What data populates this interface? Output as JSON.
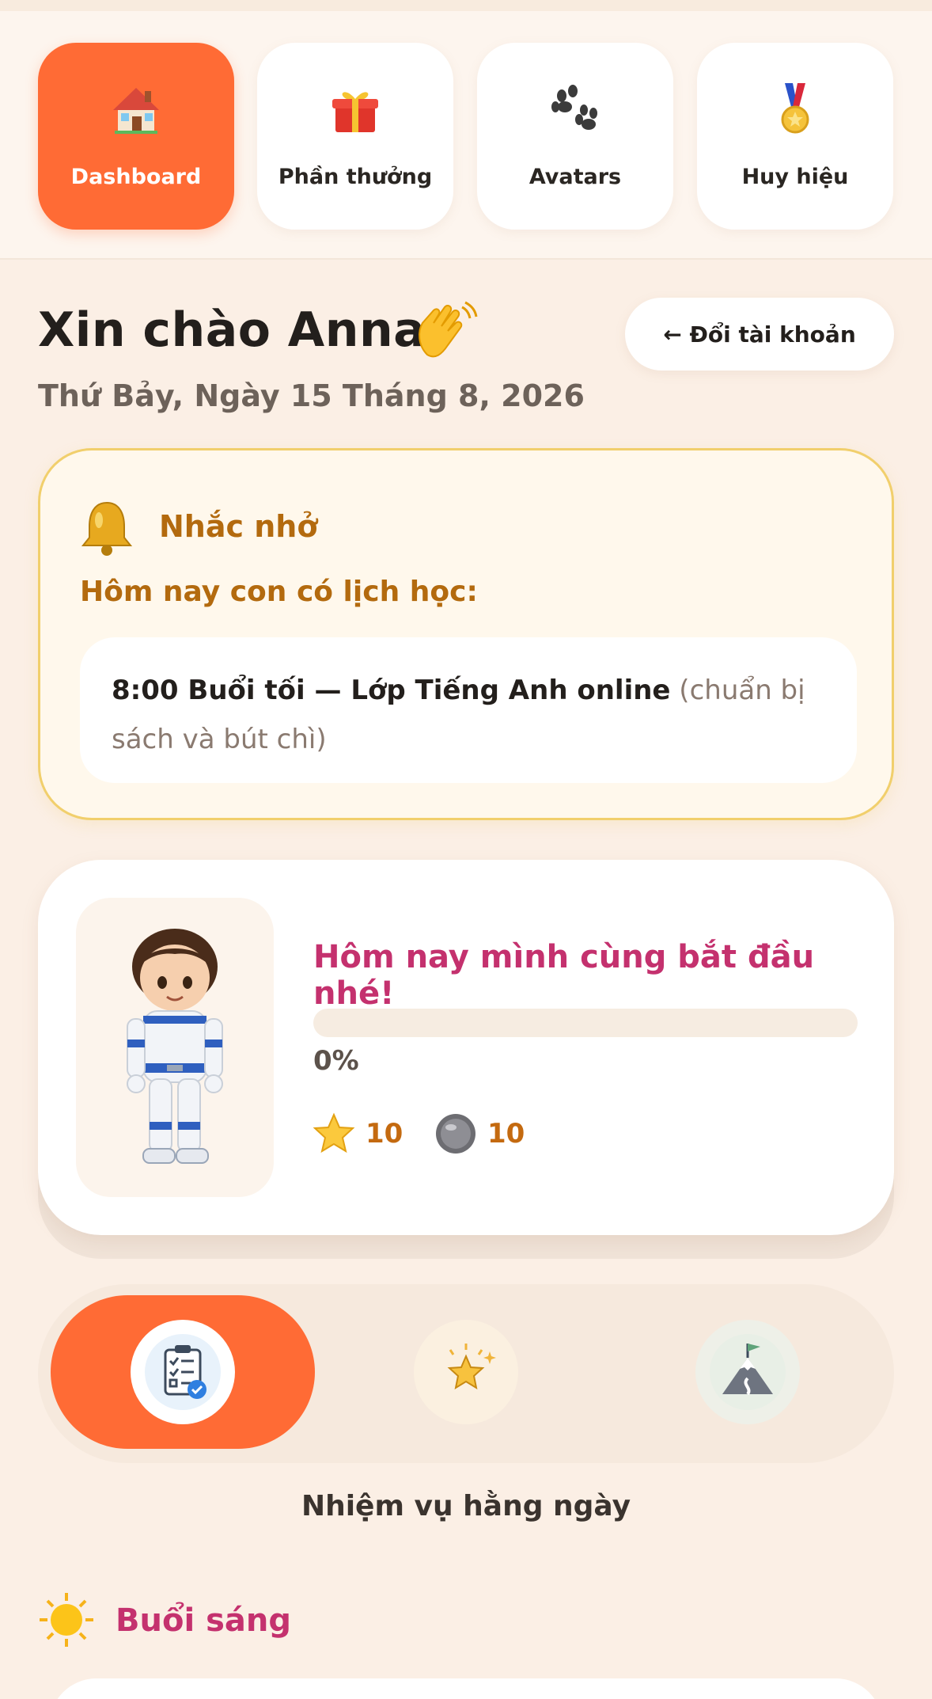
{
  "nav": {
    "tabs": [
      {
        "label": "Dashboard",
        "icon": "house-icon",
        "active": true
      },
      {
        "label": "Phần thưởng",
        "icon": "gift-icon",
        "active": false
      },
      {
        "label": "Avatars",
        "icon": "paw-icon",
        "active": false
      },
      {
        "label": "Huy hiệu",
        "icon": "medal-icon",
        "active": false
      }
    ]
  },
  "header": {
    "greeting": "Xin chào Anna",
    "date": "Thứ Bảy, Ngày 15 Tháng 8, 2026",
    "switch_account": "← Đổi tài khoản"
  },
  "reminder": {
    "title": "Nhắc nhở",
    "subtitle": "Hôm nay con có lịch học:",
    "item_main": "8:00 Buổi tối — Lớp Tiếng Anh online",
    "item_note": " (chuẩn bị sách và bút chì)"
  },
  "profile": {
    "title": "Hôm nay mình cùng bắt đầu nhé!",
    "progress_percent": 0,
    "progress_label": "0%",
    "stars": "10",
    "coins": "10"
  },
  "modes": {
    "items": [
      {
        "icon": "checklist-icon",
        "active": true
      },
      {
        "icon": "star-icon",
        "active": false
      },
      {
        "icon": "mountain-flag-icon",
        "active": false
      }
    ],
    "active_label": "Nhiệm vụ hằng ngày"
  },
  "section": {
    "title": "Buổi sáng"
  },
  "colors": {
    "accent": "#ff6b35",
    "pink": "#c4316e",
    "amber": "#b36a0e",
    "background": "#fbefe5"
  }
}
